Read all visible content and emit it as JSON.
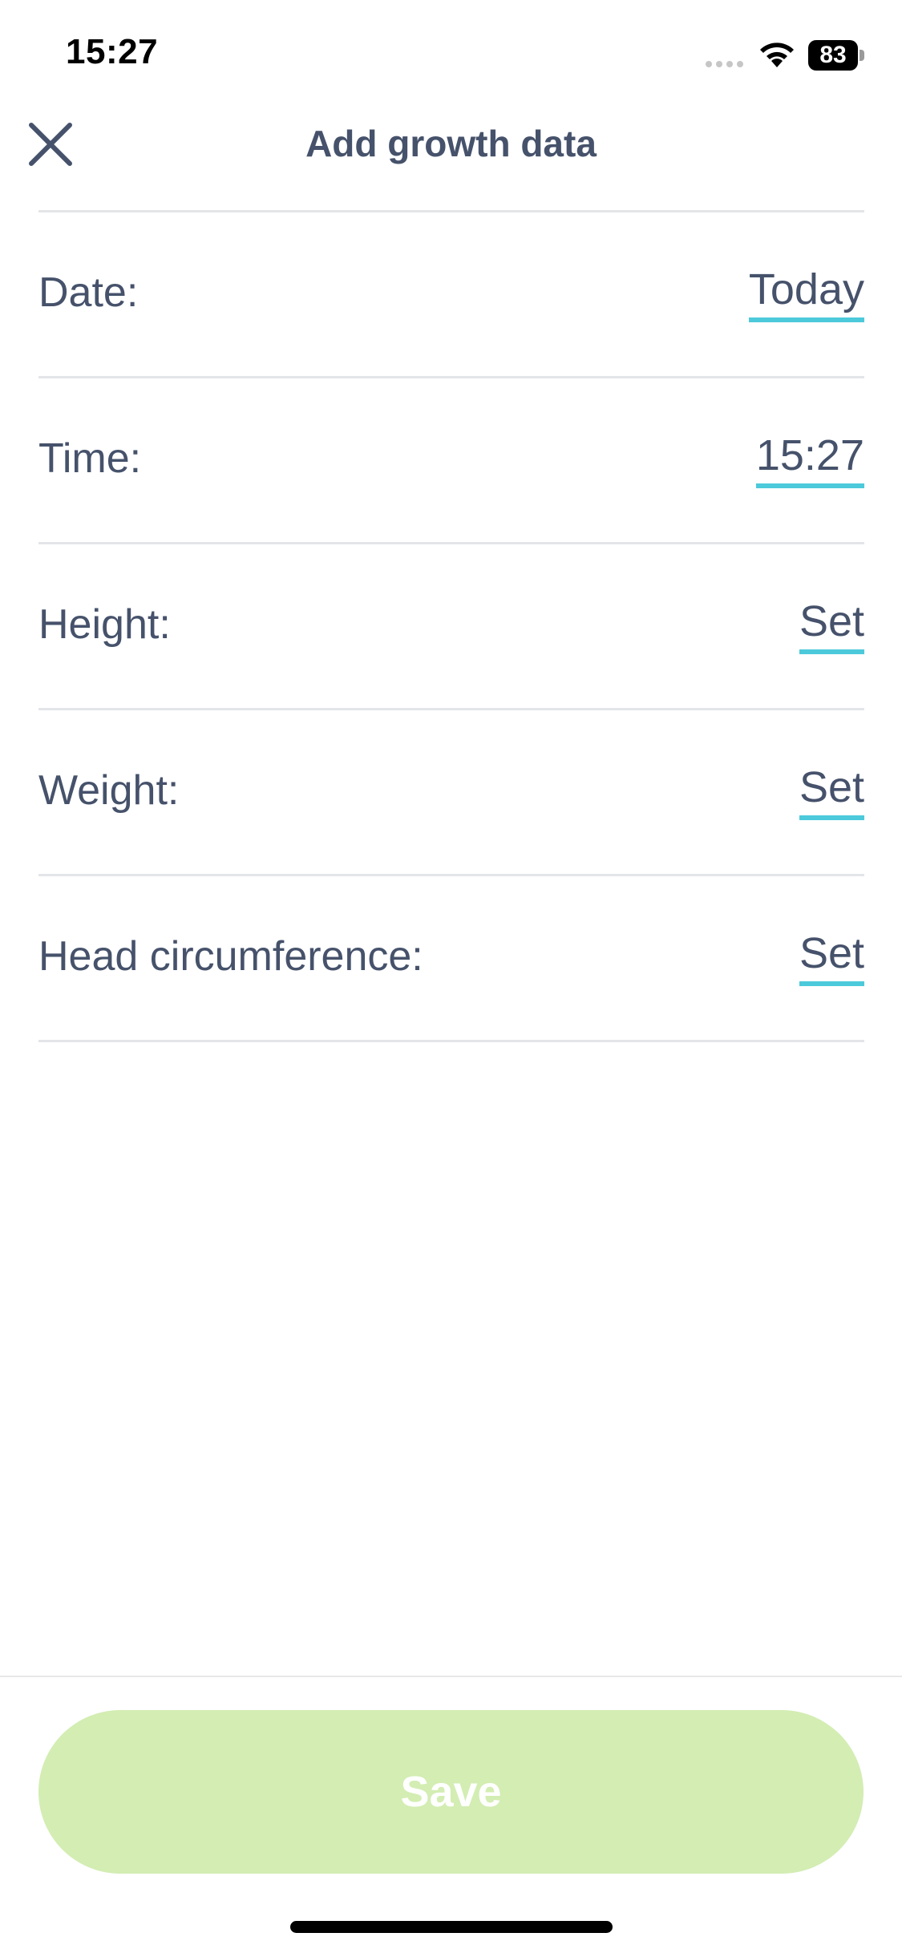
{
  "status_bar": {
    "time": "15:27",
    "battery_level": "83",
    "icons": [
      "cellular-signal-icon",
      "wifi-icon",
      "battery-icon"
    ]
  },
  "header": {
    "title": "Add growth data",
    "close_icon": "close-icon"
  },
  "form": {
    "rows": [
      {
        "label": "Date:",
        "value": "Today"
      },
      {
        "label": "Time:",
        "value": "15:27"
      },
      {
        "label": "Height:",
        "value": "Set"
      },
      {
        "label": "Weight:",
        "value": "Set"
      },
      {
        "label": "Head circumference:",
        "value": "Set"
      }
    ]
  },
  "footer": {
    "save_label": "Save"
  },
  "colors": {
    "text": "#46526b",
    "accent_underline": "#4ccadb",
    "save_button_disabled": "#d3edb3",
    "divider": "#e3e5e8"
  }
}
